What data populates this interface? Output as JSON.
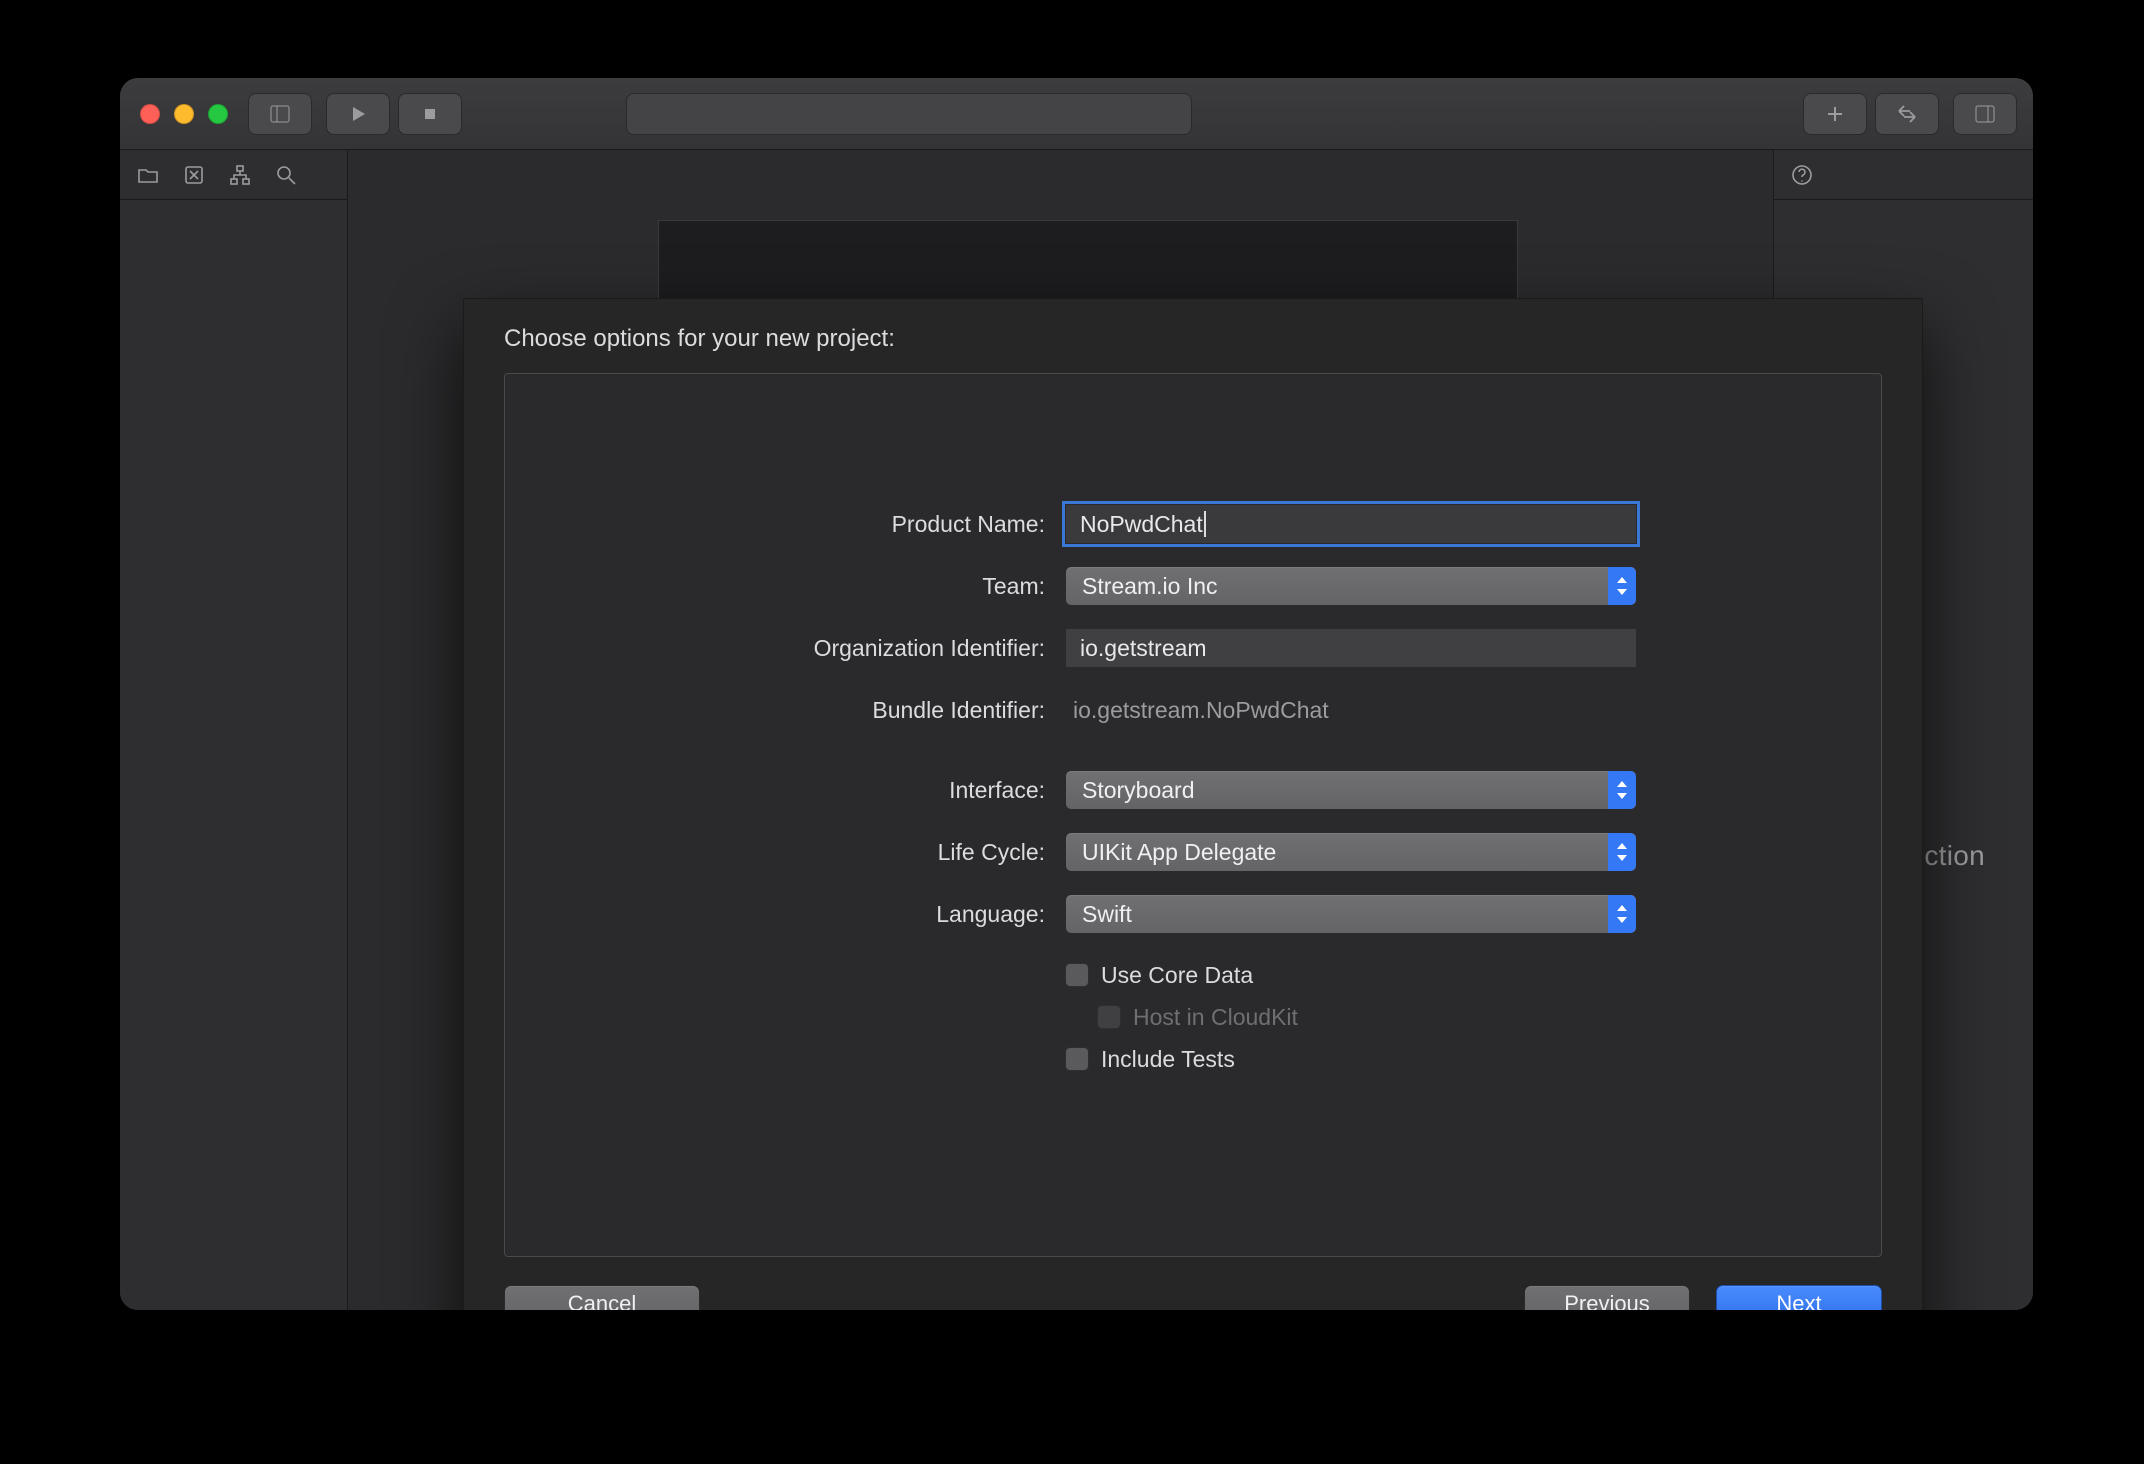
{
  "toolbar": {
    "traffic": [
      "close",
      "minimize",
      "zoom"
    ]
  },
  "sidebar_icons": [
    "folder-icon",
    "error-icon",
    "hierarchy-icon",
    "search-icon"
  ],
  "right_icons": [
    "help-icon"
  ],
  "background_hint": "ction",
  "dialog": {
    "title": "Choose options for your new project:",
    "fields": {
      "product_name_label": "Product Name:",
      "product_name_value": "NoPwdChat",
      "team_label": "Team:",
      "team_value": "Stream.io Inc",
      "org_id_label": "Organization Identifier:",
      "org_id_value": "io.getstream",
      "bundle_id_label": "Bundle Identifier:",
      "bundle_id_value": "io.getstream.NoPwdChat",
      "interface_label": "Interface:",
      "interface_value": "Storyboard",
      "lifecycle_label": "Life Cycle:",
      "lifecycle_value": "UIKit App Delegate",
      "language_label": "Language:",
      "language_value": "Swift",
      "use_core_data_label": "Use Core Data",
      "host_cloudkit_label": "Host in CloudKit",
      "include_tests_label": "Include Tests"
    },
    "buttons": {
      "cancel": "Cancel",
      "previous": "Previous",
      "next": "Next"
    }
  }
}
